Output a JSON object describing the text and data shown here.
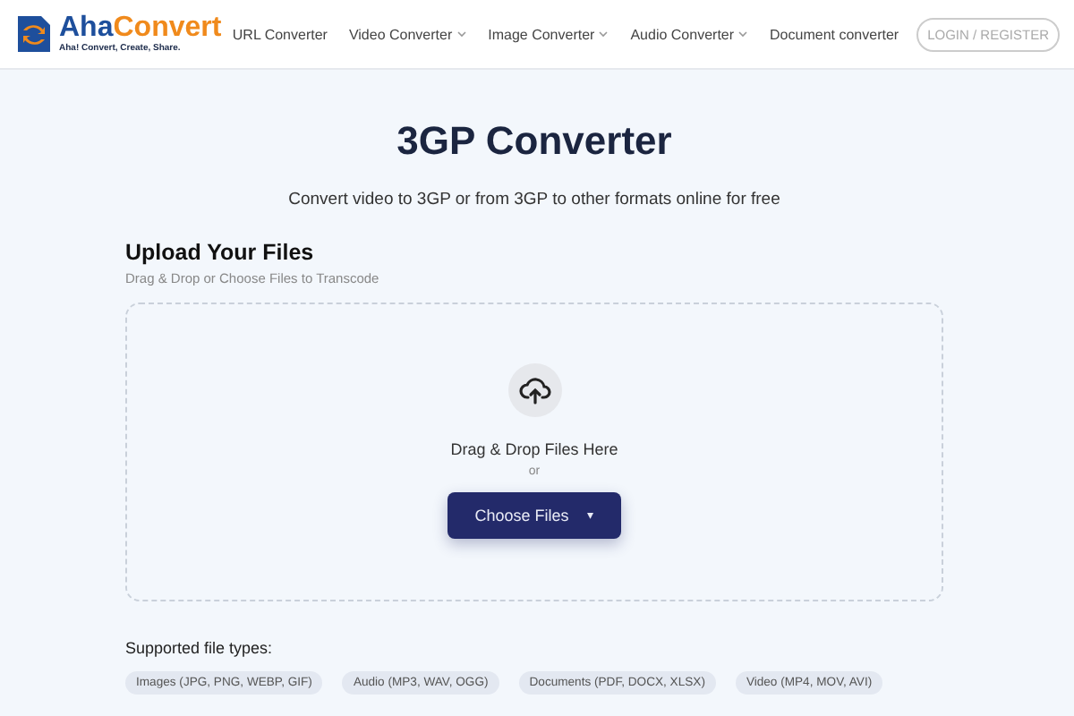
{
  "header": {
    "logo": {
      "name_part1": "Aha",
      "name_part2": "Convert",
      "tagline": "Aha! Convert, Create, Share."
    },
    "nav": [
      {
        "label": "URL Converter",
        "dropdown": false
      },
      {
        "label": "Video Converter",
        "dropdown": true
      },
      {
        "label": "Image Converter",
        "dropdown": true
      },
      {
        "label": "Audio Converter",
        "dropdown": true
      },
      {
        "label": "Document converter",
        "dropdown": false
      }
    ],
    "login": "LOGIN / REGISTER"
  },
  "title": "3GP Converter",
  "subtitle": "Convert video to 3GP or from 3GP to other formats online for free",
  "upload": {
    "heading": "Upload Your Files",
    "hint": "Drag & Drop or Choose Files to Transcode",
    "drop_text": "Drag & Drop Files Here",
    "or": "or",
    "button": "Choose Files",
    "button_caret": "▾"
  },
  "supported": {
    "label": "Supported file types:",
    "types": [
      "Images (JPG, PNG, WEBP, GIF)",
      "Audio (MP3, WAV, OGG)",
      "Documents (PDF, DOCX, XLSX)",
      "Video (MP4, MOV, AVI)"
    ]
  }
}
